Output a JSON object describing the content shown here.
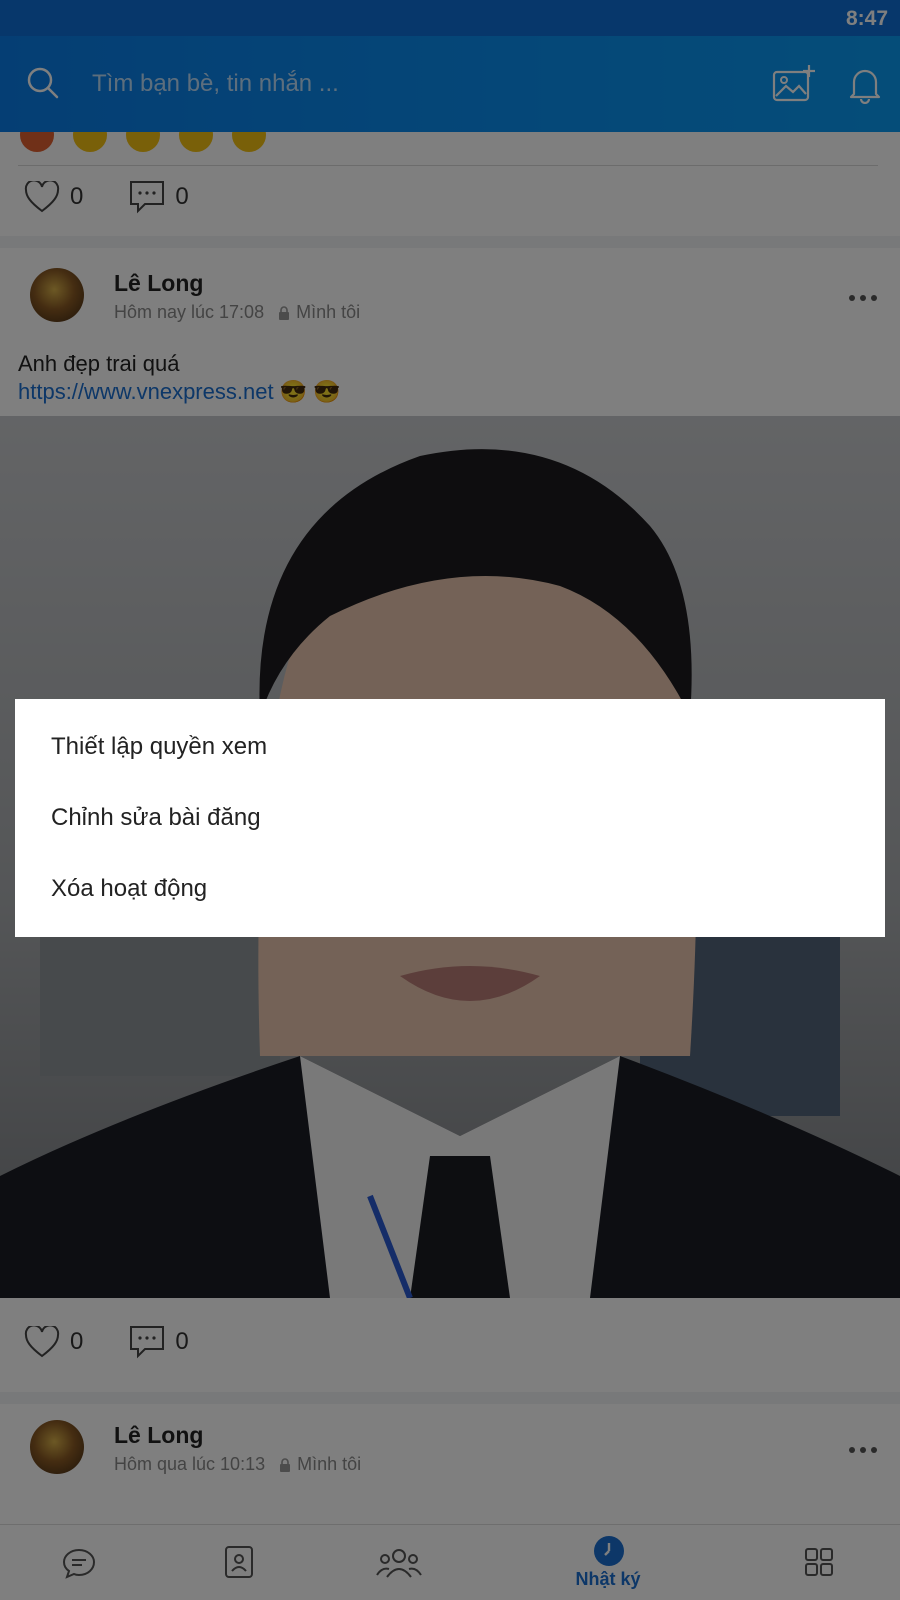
{
  "status_bar": {
    "time": "8:47"
  },
  "header": {
    "search_placeholder": "Tìm bạn bè, tin nhắn ..."
  },
  "feed": {
    "prev_post": {
      "likes": "0",
      "comments": "0"
    },
    "post": {
      "author": "Lê Long",
      "time": "Hôm nay lúc 17:08",
      "privacy": "Mình tôi",
      "text": "Anh đẹp trai quá",
      "link": "https://www.vnexpress.net",
      "emoji": "😎 😎",
      "likes": "0",
      "comments": "0"
    },
    "next_post": {
      "author": "Lê Long",
      "time": "Hôm qua lúc 10:13",
      "privacy": "Mình tôi"
    }
  },
  "bottom_nav": {
    "active_label": "Nhật ký"
  },
  "context_menu": {
    "items": [
      "Thiết lập quyền xem",
      "Chỉnh sửa bài đăng",
      "Xóa hoạt động"
    ]
  },
  "colors": {
    "accent": "#0a8ef0",
    "link": "#1a6fd0"
  }
}
